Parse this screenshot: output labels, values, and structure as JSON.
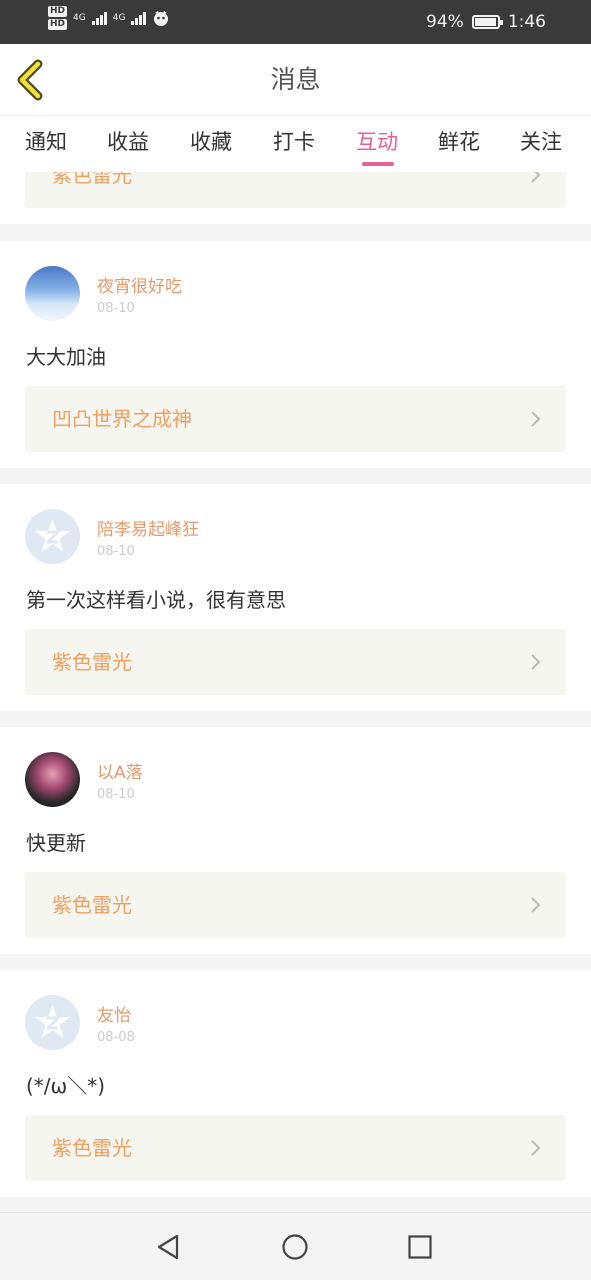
{
  "status_bar": {
    "hd_top": "HD",
    "hd_bottom": "HD",
    "net1": "4G",
    "net2": "4G",
    "battery_text": "94%",
    "time": "1:46"
  },
  "header": {
    "title": "消息"
  },
  "tabs": [
    {
      "label": "通知"
    },
    {
      "label": "收益"
    },
    {
      "label": "收藏"
    },
    {
      "label": "打卡"
    },
    {
      "label": "互动"
    },
    {
      "label": "鲜花"
    },
    {
      "label": "关注"
    }
  ],
  "active_tab": "互动",
  "partial_card": {
    "book_title": "紫色雷光"
  },
  "messages": [
    {
      "username": "夜宵很好吃",
      "date": "08-10",
      "comment": "大大加油",
      "book_title": "凹凸世界之成神",
      "avatar": "sky-avatar"
    },
    {
      "username": "陪李易起峰狂",
      "date": "08-10",
      "comment": "第一次这样看小说，很有意思",
      "book_title": "紫色雷光",
      "avatar": "default-avatar"
    },
    {
      "username": "以A落",
      "date": "08-10",
      "comment": "快更新",
      "book_title": "紫色雷光",
      "avatar": "anime-avatar"
    },
    {
      "username": "友怡",
      "date": "08-08",
      "comment": "(*/ω＼*)",
      "book_title": "紫色雷光",
      "avatar": "default-avatar"
    }
  ],
  "colors": {
    "accent": "#e8609a",
    "username": "#e89a6a",
    "book_title": "#f0a060",
    "status_bar": "#3a3a3a"
  },
  "icons": {
    "back": "chevron-left-icon",
    "link": "chevron-right-icon",
    "nav_back": "triangle-back-icon",
    "nav_home": "circle-home-icon",
    "nav_recent": "square-recent-icon"
  }
}
